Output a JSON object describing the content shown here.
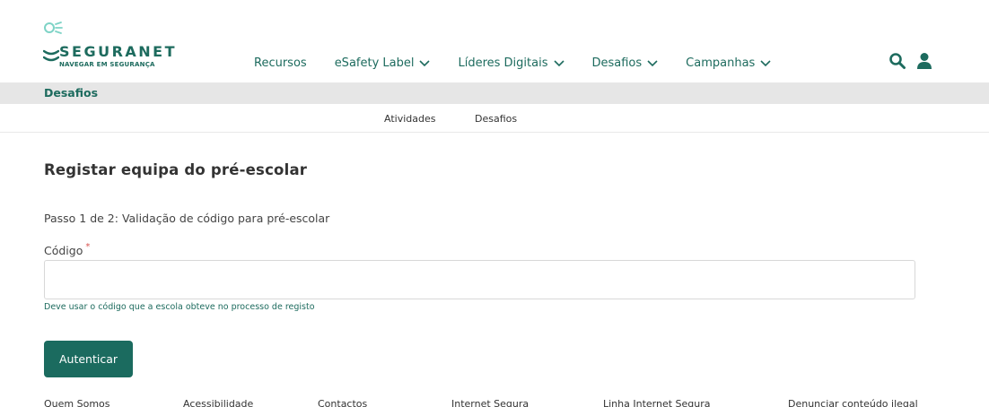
{
  "brand": {
    "name": "SEGURANET",
    "tagline": "NAVEGAR EM SEGURANÇA",
    "color": "#1d6b5e"
  },
  "nav": {
    "items": [
      {
        "label": "Recursos"
      },
      {
        "label": "eSafety Label"
      },
      {
        "label": "Líderes Digitais"
      },
      {
        "label": "Desafios"
      },
      {
        "label": "Campanhas"
      }
    ],
    "icons": [
      "search-icon",
      "user-icon"
    ]
  },
  "breadcrumb": {
    "current": "Desafios"
  },
  "subnav": {
    "items": [
      {
        "label": "Atividades"
      },
      {
        "label": "Desafios"
      }
    ]
  },
  "form": {
    "title": "Registar equipa do pré-escolar",
    "step": "Passo 1 de 2: Validação de código para pré-escolar",
    "code_label": "Código",
    "required_mark": "*",
    "code_value": "",
    "hint": "Deve usar o código que a escola obteve no processo de registo",
    "submit_label": "Autenticar",
    "button_color": "#1b6b5f"
  },
  "footer": {
    "links": [
      {
        "label": "Quem Somos"
      },
      {
        "label": "Acessibilidade"
      },
      {
        "label": "Contactos"
      },
      {
        "label": "Internet Segura"
      },
      {
        "label": "Linha Internet Segura"
      },
      {
        "label": "Denunciar conteúdo ilegal"
      }
    ]
  }
}
